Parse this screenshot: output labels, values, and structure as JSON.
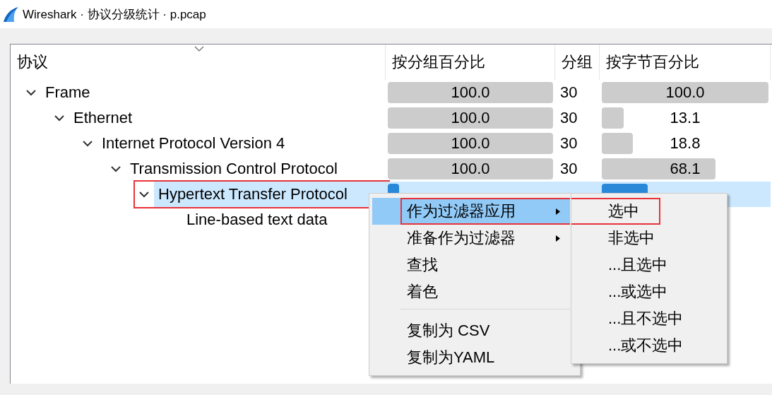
{
  "window": {
    "title": "Wireshark · 协议分级统计 · p.pcap"
  },
  "table": {
    "columns": [
      "协议",
      "按分组百分比",
      "分组",
      "按字节百分比"
    ],
    "rows": [
      {
        "protocol": "Frame",
        "expanded": true,
        "selected": false,
        "highlighted": false,
        "packets_share": {
          "text": "100.0"
        },
        "packets": "30",
        "bytes_share": {
          "text": "100.0"
        },
        "children": [
          {
            "protocol": "Ethernet",
            "expanded": true,
            "selected": false,
            "highlighted": false,
            "packets_share": {
              "text": "100.0"
            },
            "packets": "30",
            "bytes_share": {
              "text": "13.1"
            },
            "children": [
              {
                "protocol": "Internet Protocol Version 4",
                "expanded": true,
                "selected": false,
                "highlighted": false,
                "packets_share": {
                  "text": "100.0"
                },
                "packets": "30",
                "bytes_share": {
                  "text": "18.8"
                },
                "children": [
                  {
                    "protocol": "Transmission Control Protocol",
                    "expanded": true,
                    "selected": false,
                    "highlighted": false,
                    "packets_share": {
                      "text": "100.0"
                    },
                    "packets": "30",
                    "bytes_share": {
                      "text": "68.1"
                    },
                    "children": [
                      {
                        "protocol": "Hypertext Transfer Protocol",
                        "expanded": true,
                        "selected": true,
                        "highlighted": true,
                        "children": [
                          {
                            "protocol": "Line-based text data",
                            "selected": false,
                            "highlighted": false
                          }
                        ]
                      }
                    ]
                  }
                ]
              }
            ]
          }
        ]
      }
    ]
  },
  "context_menu": {
    "items": [
      {
        "kind": "item",
        "label": "作为过滤器应用",
        "has_submenu": true,
        "selected": true,
        "highlighted": true
      },
      {
        "kind": "item",
        "label": "准备作为过滤器",
        "has_submenu": true,
        "selected": false
      },
      {
        "kind": "item",
        "label": "查找",
        "selected": false
      },
      {
        "kind": "item",
        "label": "着色",
        "selected": false
      },
      {
        "kind": "separator"
      },
      {
        "kind": "item",
        "label": "复制为 CSV",
        "selected": false
      },
      {
        "kind": "item",
        "label": "复制为YAML",
        "selected": false
      }
    ]
  },
  "submenu": {
    "items": [
      {
        "label": "选中",
        "selected": false,
        "highlighted": true
      },
      {
        "label": "非选中",
        "selected": false
      },
      {
        "label": "...且选中",
        "selected": false
      },
      {
        "label": "...或选中",
        "selected": false
      },
      {
        "label": "...且不选中",
        "selected": false
      },
      {
        "label": "...或不选中",
        "selected": false
      }
    ]
  }
}
